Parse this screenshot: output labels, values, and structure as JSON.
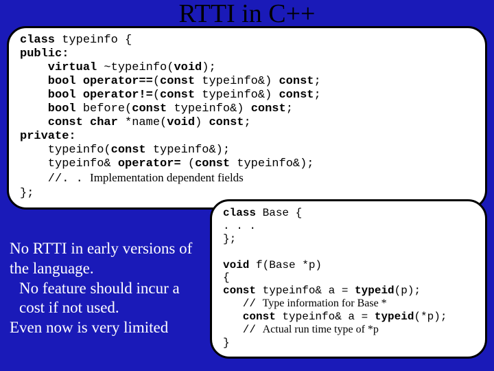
{
  "title": "RTTI in C++",
  "code_box_1": {
    "l1a": "class",
    "l1b": " typeinfo {",
    "l2a": "public:",
    "l3a": "    virtual",
    "l3b": " ~typeinfo(",
    "l3c": "void",
    "l3d": ");",
    "l4a": "    bool operator==",
    "l4b": "(",
    "l4c": "const",
    "l4d": " typeinfo&) ",
    "l4e": "const",
    "l4f": ";",
    "l5a": "    bool operator!=",
    "l5b": "(",
    "l5c": "const",
    "l5d": " typeinfo&) ",
    "l5e": "const",
    "l5f": ";",
    "l6a": "    bool",
    "l6b": " before(",
    "l6c": "const",
    "l6d": " typeinfo&) ",
    "l6e": "const",
    "l6f": ";",
    "l7a": "    const char",
    "l7b": " *name(",
    "l7c": "void",
    "l7d": ") ",
    "l7e": "const",
    "l7f": ";",
    "l8a": "private:",
    "l9a": "    typeinfo(",
    "l9b": "const",
    "l9c": " typeinfo&);",
    "l10a": "    typeinfo& ",
    "l10b": "operator=",
    "l10c": " (",
    "l10d": "const",
    "l10e": " typeinfo&);",
    "l11a": "    //. . ",
    "l11b": "Implementation dependent fields",
    "l12a": "};"
  },
  "code_box_2": {
    "l1a": "class",
    "l1b": " Base {",
    "l2a": ". . .",
    "l3a": "};",
    "blank1": "",
    "l4a": "void",
    "l4b": " f(Base *p)",
    "l5a": "{",
    "l6a": "const",
    "l6b": " typeinfo& a = ",
    "l6c": "typeid",
    "l6d": "(p);",
    "l7a": "   // ",
    "l7b": "Type information for Base *",
    "l8a": "   const",
    "l8b": " typeinfo& a = ",
    "l8c": "typeid",
    "l8d": "(*p);",
    "l9a": "   // ",
    "l9b": "Actual run time type of *p",
    "l10a": "}"
  },
  "note": {
    "p1": "No RTTI in early versions of the language.",
    "p2": "No feature should incur a cost if not used.",
    "p3": "Even now is very limited"
  }
}
